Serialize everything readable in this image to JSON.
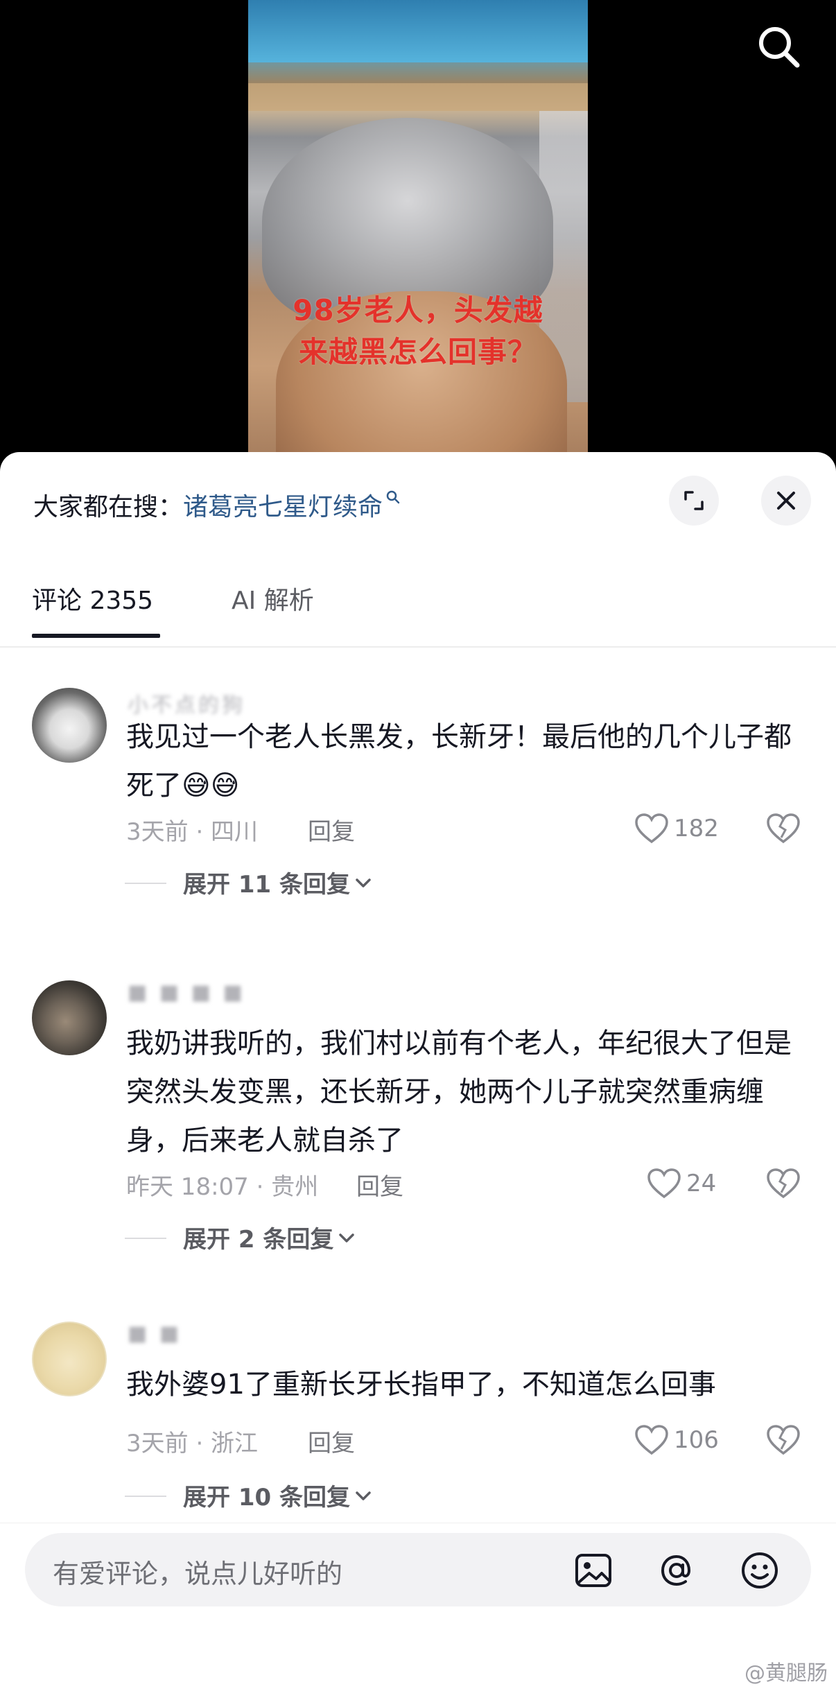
{
  "video": {
    "caption_line1": "98岁老人，头发越",
    "caption_line2": "来越黑怎么回事？"
  },
  "search_tip": {
    "prefix": "大家都在搜：",
    "keyword": "诸葛亮七星灯续命"
  },
  "tabs": {
    "comments": "评论 2355",
    "ai": "AI 解析"
  },
  "comments": [
    {
      "username": "小不点的狗",
      "text": "我见过一个老人长黑发，长新牙！最后他的几个儿子都死了😅😅",
      "meta": "3天前 · 四川",
      "reply_label": "回复",
      "likes": "182",
      "expand_label": "展开 11 条回复"
    },
    {
      "username": "■ ■ ■ ■",
      "text": "我奶讲我听的，我们村以前有个老人，年纪很大了但是突然头发变黑，还长新牙，她两个儿子就突然重病缠身，后来老人就自杀了",
      "meta": "昨天 18:07 · 贵州",
      "reply_label": "回复",
      "likes": "24",
      "expand_label": "展开 2 条回复"
    },
    {
      "username": "■ ■",
      "text": "我外婆91了重新长牙长指甲了，不知道怎么回事",
      "meta": "3天前 · 浙江",
      "reply_label": "回复",
      "likes": "106",
      "expand_label": "展开 10 条回复"
    }
  ],
  "input": {
    "placeholder": "有爱评论，说点儿好听的"
  },
  "watermark": "@黄腿肠",
  "icons": [
    "search-icon",
    "expand-icon",
    "close-icon",
    "heart-icon",
    "broken-heart-icon",
    "chevron-down-icon",
    "image-icon",
    "at-icon",
    "emoji-icon"
  ]
}
